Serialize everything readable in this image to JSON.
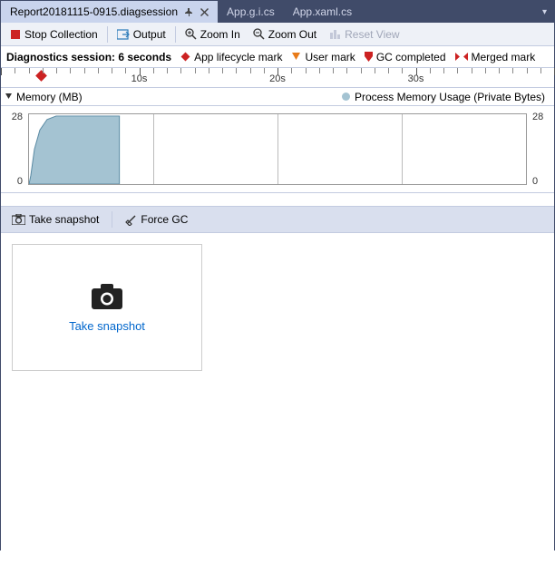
{
  "tabs": [
    {
      "label": "Report20181115-0915.diagsession",
      "active": true
    },
    {
      "label": "App.g.i.cs",
      "active": false
    },
    {
      "label": "App.xaml.cs",
      "active": false
    }
  ],
  "toolbar": {
    "stop": "Stop Collection",
    "output": "Output",
    "zoom_in": "Zoom In",
    "zoom_out": "Zoom Out",
    "reset": "Reset View"
  },
  "session": {
    "label": "Diagnostics session:",
    "duration": "6 seconds"
  },
  "legend": {
    "lifecycle": "App lifecycle mark",
    "user": "User mark",
    "gc": "GC completed",
    "merged": "Merged mark"
  },
  "ruler": {
    "labels": [
      "10s",
      "20s",
      "30s"
    ]
  },
  "memory": {
    "title": "Memory (MB)",
    "series_label": "Process Memory Usage (Private Bytes)",
    "ymax": "28",
    "ymin": "0"
  },
  "actions": {
    "take_snapshot": "Take snapshot",
    "force_gc": "Force GC"
  },
  "snapshot_box": {
    "label": "Take snapshot"
  },
  "chart_data": {
    "type": "area",
    "ylabel": "Memory (MB)",
    "ylim": [
      0,
      28
    ],
    "xrange_seconds": [
      0,
      40
    ],
    "visible_extent_seconds": 6,
    "series": [
      {
        "name": "Process Memory Usage (Private Bytes)",
        "x": [
          0,
          0.5,
          1,
          1.5,
          2,
          6
        ],
        "y": [
          0,
          15,
          22,
          26,
          28,
          28
        ]
      }
    ],
    "markers": {
      "app_lifecycle_at_seconds": [
        2.5
      ]
    }
  }
}
